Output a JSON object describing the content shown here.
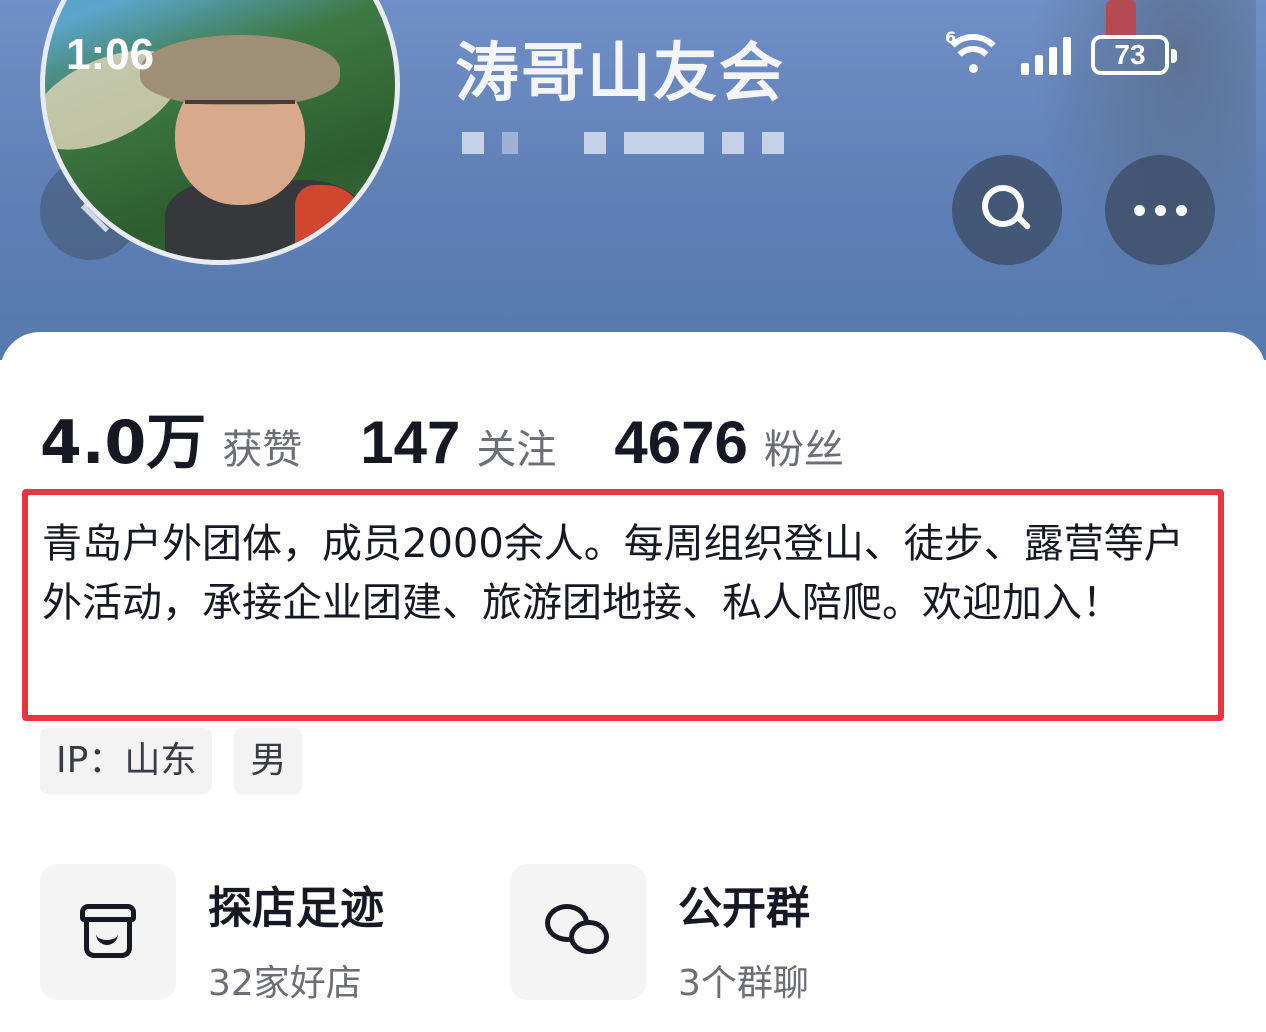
{
  "status_bar": {
    "time": "1:06",
    "wifi_label": "6",
    "battery": "73"
  },
  "header": {
    "title": "涛哥山友会",
    "icons": {
      "back": "chevron-left-icon",
      "search": "search-icon",
      "more": "more-icon"
    }
  },
  "stats": [
    {
      "value": "4.0万",
      "label": "获赞"
    },
    {
      "value": "147",
      "label": "关注"
    },
    {
      "value": "4676",
      "label": "粉丝"
    }
  ],
  "bio": {
    "text": "青岛户外团体，成员2000余人。每周组织登山、徒步、露营等户外活动，承接企业团建、旅游团地接、私人陪爬。欢迎加入！",
    "highlight_color": "#e8363f"
  },
  "tags": [
    "IP：山东",
    "男"
  ],
  "tiles": [
    {
      "title": "探店足迹",
      "subtitle": "32家好店",
      "icon": "shop-icon"
    },
    {
      "title": "公开群",
      "subtitle": "3个群聊",
      "icon": "chat-bubbles-icon"
    }
  ],
  "colors": {
    "header_bg": "#6484bb",
    "text_primary": "#161823",
    "text_secondary": "#6b6e76"
  }
}
